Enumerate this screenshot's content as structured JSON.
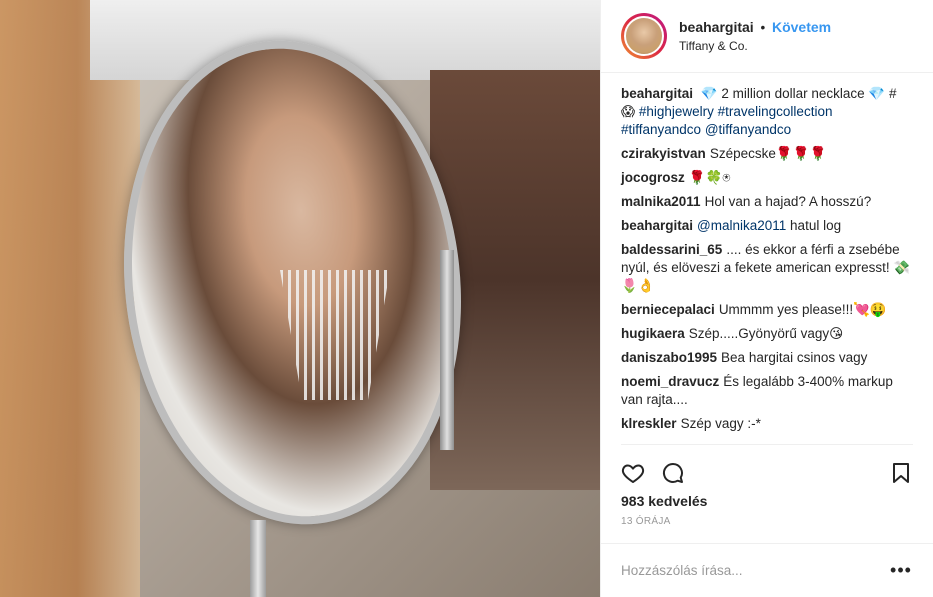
{
  "header": {
    "username": "beahargitai",
    "dot": "•",
    "follow_label": "Követem",
    "location": "Tiffany & Co."
  },
  "caption": {
    "username": "beahargitai",
    "text_1": " 💎 2 million dollar necklace 💎 # 😱 ",
    "tag_1": "#highjewelry",
    "text_2": " ",
    "tag_2": "#travelingcollection",
    "text_3": " ",
    "tag_3": "#tiffanyandco",
    "text_4": " ",
    "tag_4": "@tiffanyandco"
  },
  "comments": [
    {
      "username": "czirakyistvan",
      "text": "Szépecske🌹🌹🌹"
    },
    {
      "username": "jocogrosz",
      "text": "🌹🍀⍟"
    },
    {
      "username": "malnika2011",
      "text": "Hol van a hajad? A hosszú?"
    },
    {
      "username": "beahargitai",
      "mention": "@malnika2011",
      "text": " hatul log"
    },
    {
      "username": "baldessarini_65",
      "text": ".... és ekkor a férfi a zsebébe nyúl, és elöveszi a fekete american expresst! 💸🌷👌"
    },
    {
      "username": "berniecepalaci",
      "text": "Ummmm yes please!!!💘🤑"
    },
    {
      "username": "hugikaera",
      "text": "Szép.....Gyönyörű vagy😘"
    },
    {
      "username": "daniszabo1995",
      "text": "Bea hargitai csinos vagy"
    },
    {
      "username": "noemi_dravucz",
      "text": "És legalább 3-400% markup van rajta...."
    },
    {
      "username": "klreskler",
      "text": "Szép vagy :-*"
    }
  ],
  "actions": {
    "icons": [
      "heart-icon",
      "comment-icon",
      "bookmark-icon"
    ]
  },
  "likes": "983 kedvelés",
  "time": "13 ÓRÁJA",
  "comment_box": {
    "placeholder": "Hozzászólás írása...",
    "more": "•••"
  },
  "colors": {
    "follow": "#3897f0",
    "tag": "#003569",
    "muted": "#999999",
    "border": "#efefef"
  }
}
